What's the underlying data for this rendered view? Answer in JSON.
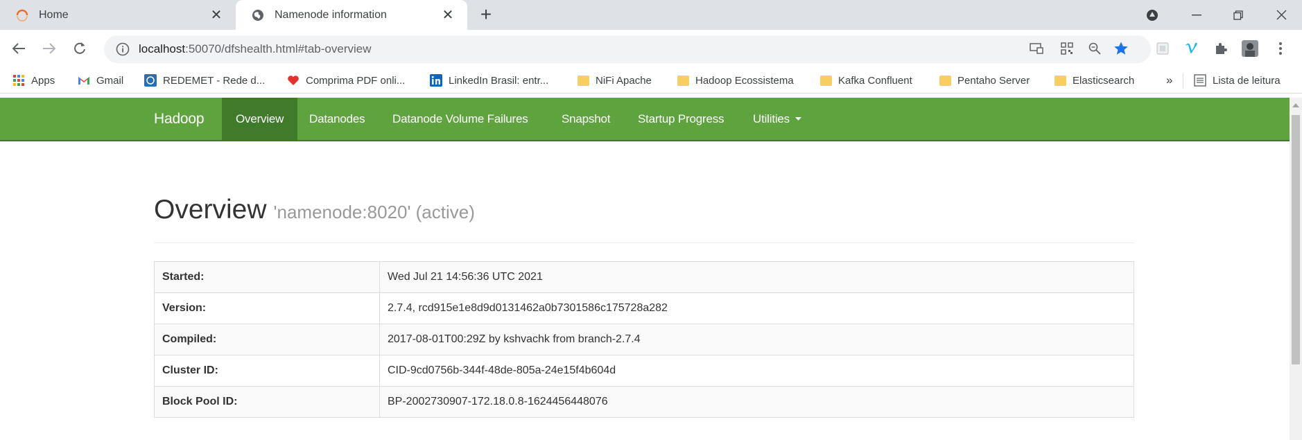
{
  "browser": {
    "tabs": [
      {
        "title": "Home",
        "active": false
      },
      {
        "title": "Namenode information",
        "active": true
      }
    ],
    "new_tab_label": "+",
    "address": {
      "host": "localhost",
      "path": ":50070/dfshealth.html#tab-overview"
    },
    "bookmarks": [
      {
        "label": "Apps",
        "icon": "apps-grid-icon"
      },
      {
        "label": "Gmail",
        "icon": "gmail-icon"
      },
      {
        "label": "REDEMET - Rede d...",
        "icon": "redemet-icon"
      },
      {
        "label": "Comprima PDF onli...",
        "icon": "heart-icon"
      },
      {
        "label": "LinkedIn Brasil: entr...",
        "icon": "linkedin-icon"
      },
      {
        "label": "NiFi Apache",
        "icon": "folder-icon"
      },
      {
        "label": "Hadoop Ecossistema",
        "icon": "folder-icon"
      },
      {
        "label": "Kafka Confluent",
        "icon": "folder-icon"
      },
      {
        "label": "Pentaho Server",
        "icon": "folder-icon"
      },
      {
        "label": "Elasticsearch",
        "icon": "folder-icon"
      }
    ],
    "bookmarks_overflow": "»",
    "reading_list": "Lista de leitura"
  },
  "navbar": {
    "brand": "Hadoop",
    "items": [
      {
        "label": "Overview",
        "active": true
      },
      {
        "label": "Datanodes",
        "active": false
      },
      {
        "label": "Datanode Volume Failures",
        "active": false
      },
      {
        "label": "Snapshot",
        "active": false
      },
      {
        "label": "Startup Progress",
        "active": false
      },
      {
        "label": "Utilities",
        "active": false,
        "dropdown": true
      }
    ]
  },
  "overview": {
    "title": "Overview",
    "subtitle": "'namenode:8020' (active)",
    "rows": [
      {
        "key": "Started:",
        "value": "Wed Jul 21 14:56:36 UTC 2021"
      },
      {
        "key": "Version:",
        "value": "2.7.4, rcd915e1e8d9d0131462a0b7301586c175728a282"
      },
      {
        "key": "Compiled:",
        "value": "2017-08-01T00:29Z by kshvachk from branch-2.7.4"
      },
      {
        "key": "Cluster ID:",
        "value": "CID-9cd0756b-344f-48de-805a-24e15f4b604d"
      },
      {
        "key": "Block Pool ID:",
        "value": "BP-2002730907-172.18.0.8-1624456448076"
      }
    ]
  },
  "colors": {
    "navbar_bg": "#5fa33e",
    "navbar_active": "#3f7b2a",
    "tabstrip_bg": "#dee1e6"
  }
}
